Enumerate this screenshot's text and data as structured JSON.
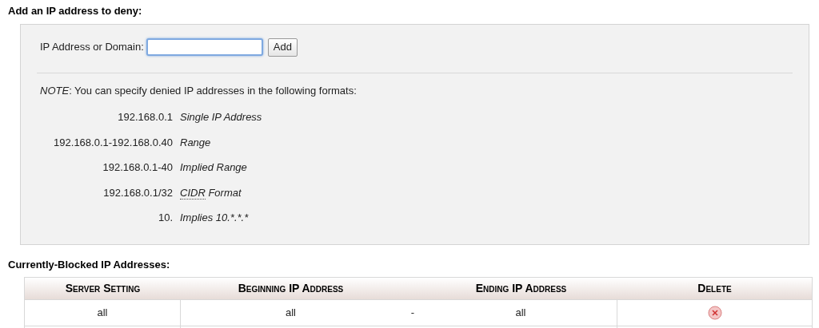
{
  "deny_section": {
    "heading": "Add an IP address to deny:",
    "field_label": "IP Address or Domain:",
    "add_button": "Add",
    "note_label": "NOTE",
    "note_text": ": You can specify denied IP addresses in the following formats:",
    "formats": [
      {
        "example": "192.168.0.1",
        "description": "Single IP Address"
      },
      {
        "example": "192.168.0.1-192.168.0.40",
        "description": "Range"
      },
      {
        "example": "192.168.0.1-40",
        "description": "Implied Range"
      },
      {
        "example": "192.168.0.1/32",
        "abbr": "CIDR",
        "description": "Format"
      },
      {
        "example": "10.",
        "description": "Implies 10.*.*.*"
      }
    ]
  },
  "blocked_section": {
    "heading": "Currently-Blocked IP Addresses:",
    "table": {
      "columns": [
        "Server Setting",
        "Beginning IP Address",
        "Ending IP Address",
        "Delete"
      ],
      "rows": [
        {
          "server_setting": "all",
          "beginning": "all",
          "separator": "-",
          "ending": "all"
        }
      ]
    }
  }
}
